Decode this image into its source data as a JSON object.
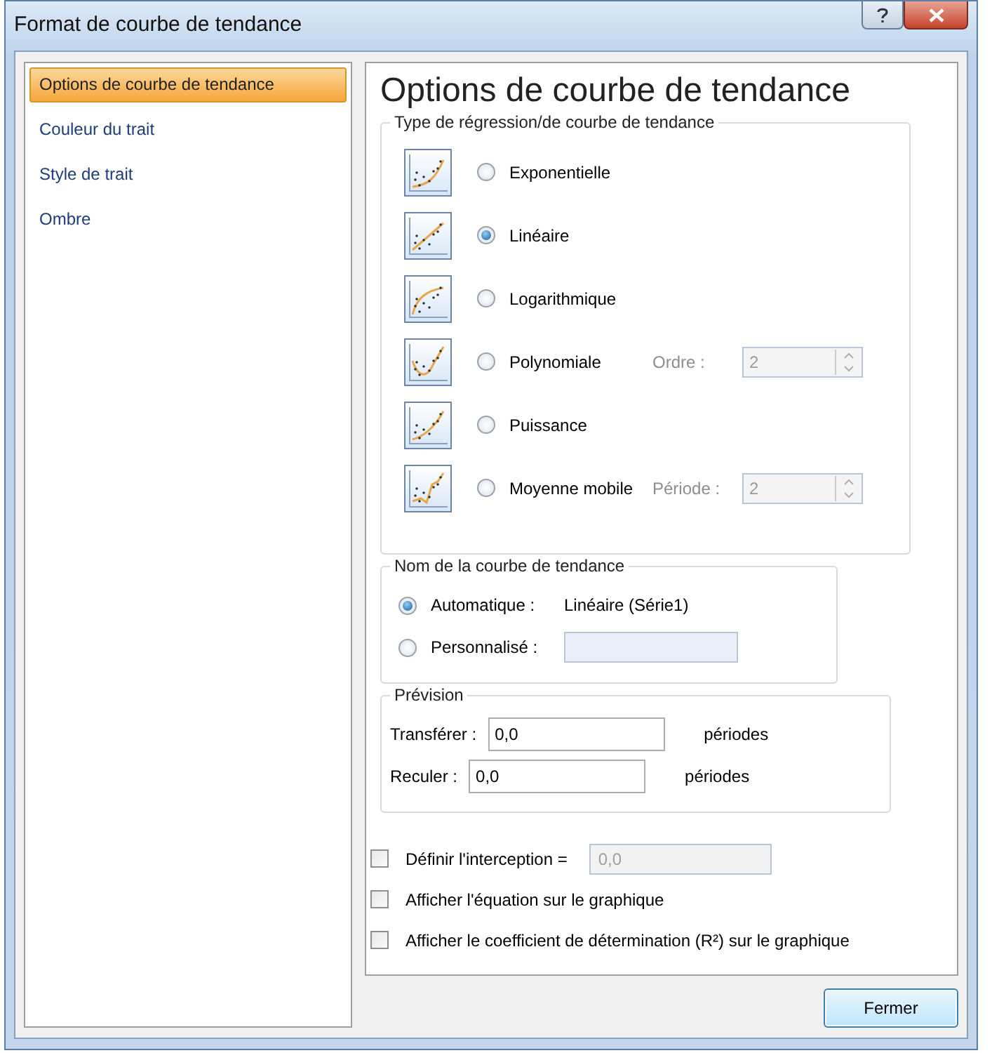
{
  "window": {
    "title": "Format de courbe de tendance"
  },
  "sidebar": {
    "items": [
      {
        "label": "Options de courbe de tendance",
        "selected": true
      },
      {
        "label": "Couleur du trait",
        "selected": false
      },
      {
        "label": "Style de trait",
        "selected": false
      },
      {
        "label": "Ombre",
        "selected": false
      }
    ]
  },
  "panel": {
    "heading": "Options de courbe de tendance",
    "regression": {
      "title": "Type de régression/de courbe de tendance",
      "options": [
        {
          "kind": "exponential",
          "label": "Exponentielle",
          "selected": false
        },
        {
          "kind": "linear",
          "label": "Linéaire",
          "selected": true
        },
        {
          "kind": "logarithmic",
          "label": "Logarithmique",
          "selected": false
        },
        {
          "kind": "polynomial",
          "label": "Polynomiale",
          "selected": false,
          "param": {
            "label": "Ordre :",
            "value": "2",
            "disabled": true
          }
        },
        {
          "kind": "power",
          "label": "Puissance",
          "selected": false
        },
        {
          "kind": "moving",
          "label": "Moyenne mobile",
          "selected": false,
          "param": {
            "label": "Période :",
            "value": "2",
            "disabled": true
          }
        }
      ]
    },
    "name": {
      "title": "Nom de la courbe de tendance",
      "options": [
        {
          "kind": "text",
          "label": "Automatique :",
          "selected": true,
          "value": "Linéaire (Série1)"
        },
        {
          "kind": "field",
          "label": "Personnalisé :",
          "selected": false
        }
      ]
    },
    "forecast": {
      "title": "Prévision",
      "rows": [
        {
          "label": "Transférer :",
          "value": "0,0",
          "unit": "périodes"
        },
        {
          "label": "Reculer :",
          "value": "0,0",
          "unit": "périodes"
        }
      ]
    },
    "checkboxes": [
      {
        "label": "Définir l'interception =",
        "checked": false,
        "field": {
          "value": "0,0",
          "disabled": true
        }
      },
      {
        "label": "Afficher l'équation sur le graphique",
        "checked": false
      },
      {
        "label": "Afficher le coefficient de détermination (R²) sur le graphique",
        "checked": false
      }
    ]
  },
  "buttons": [
    {
      "label": "Fermer"
    }
  ]
}
